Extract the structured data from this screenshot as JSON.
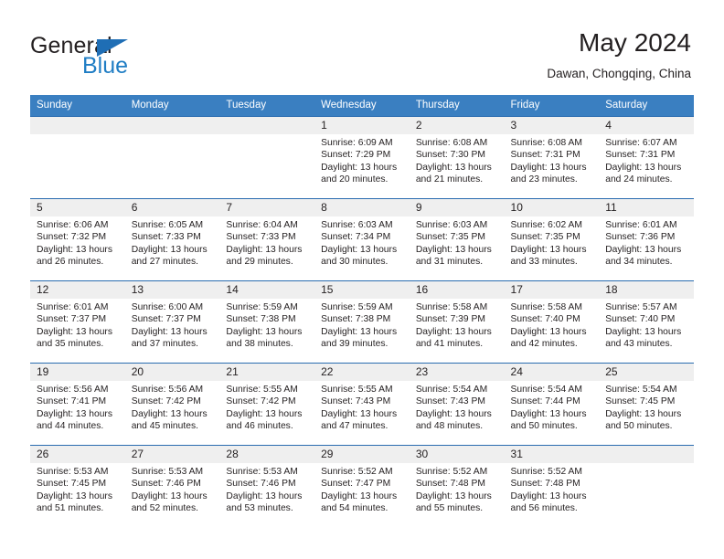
{
  "brand": {
    "word_one": "General",
    "word_two": "Blue",
    "flag_icon": "blue-triangle-flag-icon"
  },
  "header": {
    "title": "May 2024",
    "location": "Dawan, Chongqing, China"
  },
  "colors": {
    "header_blue": "#3a7fc1",
    "rule_blue": "#2a6cb0",
    "brand_blue": "#1f7dc4",
    "daynum_band": "#efefef",
    "text": "#231f20"
  },
  "calendar": {
    "weekday_headers": [
      "Sunday",
      "Monday",
      "Tuesday",
      "Wednesday",
      "Thursday",
      "Friday",
      "Saturday"
    ],
    "labels": {
      "sunrise": "Sunrise:",
      "sunset": "Sunset:",
      "daylight": "Daylight:"
    },
    "weeks": [
      [
        {
          "day": "",
          "empty": true
        },
        {
          "day": "",
          "empty": true
        },
        {
          "day": "",
          "empty": true
        },
        {
          "day": "1",
          "sunrise": "Sunrise: 6:09 AM",
          "sunset": "Sunset: 7:29 PM",
          "daylight_1": "Daylight: 13 hours",
          "daylight_2": "and 20 minutes."
        },
        {
          "day": "2",
          "sunrise": "Sunrise: 6:08 AM",
          "sunset": "Sunset: 7:30 PM",
          "daylight_1": "Daylight: 13 hours",
          "daylight_2": "and 21 minutes."
        },
        {
          "day": "3",
          "sunrise": "Sunrise: 6:08 AM",
          "sunset": "Sunset: 7:31 PM",
          "daylight_1": "Daylight: 13 hours",
          "daylight_2": "and 23 minutes."
        },
        {
          "day": "4",
          "sunrise": "Sunrise: 6:07 AM",
          "sunset": "Sunset: 7:31 PM",
          "daylight_1": "Daylight: 13 hours",
          "daylight_2": "and 24 minutes."
        }
      ],
      [
        {
          "day": "5",
          "sunrise": "Sunrise: 6:06 AM",
          "sunset": "Sunset: 7:32 PM",
          "daylight_1": "Daylight: 13 hours",
          "daylight_2": "and 26 minutes."
        },
        {
          "day": "6",
          "sunrise": "Sunrise: 6:05 AM",
          "sunset": "Sunset: 7:33 PM",
          "daylight_1": "Daylight: 13 hours",
          "daylight_2": "and 27 minutes."
        },
        {
          "day": "7",
          "sunrise": "Sunrise: 6:04 AM",
          "sunset": "Sunset: 7:33 PM",
          "daylight_1": "Daylight: 13 hours",
          "daylight_2": "and 29 minutes."
        },
        {
          "day": "8",
          "sunrise": "Sunrise: 6:03 AM",
          "sunset": "Sunset: 7:34 PM",
          "daylight_1": "Daylight: 13 hours",
          "daylight_2": "and 30 minutes."
        },
        {
          "day": "9",
          "sunrise": "Sunrise: 6:03 AM",
          "sunset": "Sunset: 7:35 PM",
          "daylight_1": "Daylight: 13 hours",
          "daylight_2": "and 31 minutes."
        },
        {
          "day": "10",
          "sunrise": "Sunrise: 6:02 AM",
          "sunset": "Sunset: 7:35 PM",
          "daylight_1": "Daylight: 13 hours",
          "daylight_2": "and 33 minutes."
        },
        {
          "day": "11",
          "sunrise": "Sunrise: 6:01 AM",
          "sunset": "Sunset: 7:36 PM",
          "daylight_1": "Daylight: 13 hours",
          "daylight_2": "and 34 minutes."
        }
      ],
      [
        {
          "day": "12",
          "sunrise": "Sunrise: 6:01 AM",
          "sunset": "Sunset: 7:37 PM",
          "daylight_1": "Daylight: 13 hours",
          "daylight_2": "and 35 minutes."
        },
        {
          "day": "13",
          "sunrise": "Sunrise: 6:00 AM",
          "sunset": "Sunset: 7:37 PM",
          "daylight_1": "Daylight: 13 hours",
          "daylight_2": "and 37 minutes."
        },
        {
          "day": "14",
          "sunrise": "Sunrise: 5:59 AM",
          "sunset": "Sunset: 7:38 PM",
          "daylight_1": "Daylight: 13 hours",
          "daylight_2": "and 38 minutes."
        },
        {
          "day": "15",
          "sunrise": "Sunrise: 5:59 AM",
          "sunset": "Sunset: 7:38 PM",
          "daylight_1": "Daylight: 13 hours",
          "daylight_2": "and 39 minutes."
        },
        {
          "day": "16",
          "sunrise": "Sunrise: 5:58 AM",
          "sunset": "Sunset: 7:39 PM",
          "daylight_1": "Daylight: 13 hours",
          "daylight_2": "and 41 minutes."
        },
        {
          "day": "17",
          "sunrise": "Sunrise: 5:58 AM",
          "sunset": "Sunset: 7:40 PM",
          "daylight_1": "Daylight: 13 hours",
          "daylight_2": "and 42 minutes."
        },
        {
          "day": "18",
          "sunrise": "Sunrise: 5:57 AM",
          "sunset": "Sunset: 7:40 PM",
          "daylight_1": "Daylight: 13 hours",
          "daylight_2": "and 43 minutes."
        }
      ],
      [
        {
          "day": "19",
          "sunrise": "Sunrise: 5:56 AM",
          "sunset": "Sunset: 7:41 PM",
          "daylight_1": "Daylight: 13 hours",
          "daylight_2": "and 44 minutes."
        },
        {
          "day": "20",
          "sunrise": "Sunrise: 5:56 AM",
          "sunset": "Sunset: 7:42 PM",
          "daylight_1": "Daylight: 13 hours",
          "daylight_2": "and 45 minutes."
        },
        {
          "day": "21",
          "sunrise": "Sunrise: 5:55 AM",
          "sunset": "Sunset: 7:42 PM",
          "daylight_1": "Daylight: 13 hours",
          "daylight_2": "and 46 minutes."
        },
        {
          "day": "22",
          "sunrise": "Sunrise: 5:55 AM",
          "sunset": "Sunset: 7:43 PM",
          "daylight_1": "Daylight: 13 hours",
          "daylight_2": "and 47 minutes."
        },
        {
          "day": "23",
          "sunrise": "Sunrise: 5:54 AM",
          "sunset": "Sunset: 7:43 PM",
          "daylight_1": "Daylight: 13 hours",
          "daylight_2": "and 48 minutes."
        },
        {
          "day": "24",
          "sunrise": "Sunrise: 5:54 AM",
          "sunset": "Sunset: 7:44 PM",
          "daylight_1": "Daylight: 13 hours",
          "daylight_2": "and 50 minutes."
        },
        {
          "day": "25",
          "sunrise": "Sunrise: 5:54 AM",
          "sunset": "Sunset: 7:45 PM",
          "daylight_1": "Daylight: 13 hours",
          "daylight_2": "and 50 minutes."
        }
      ],
      [
        {
          "day": "26",
          "sunrise": "Sunrise: 5:53 AM",
          "sunset": "Sunset: 7:45 PM",
          "daylight_1": "Daylight: 13 hours",
          "daylight_2": "and 51 minutes."
        },
        {
          "day": "27",
          "sunrise": "Sunrise: 5:53 AM",
          "sunset": "Sunset: 7:46 PM",
          "daylight_1": "Daylight: 13 hours",
          "daylight_2": "and 52 minutes."
        },
        {
          "day": "28",
          "sunrise": "Sunrise: 5:53 AM",
          "sunset": "Sunset: 7:46 PM",
          "daylight_1": "Daylight: 13 hours",
          "daylight_2": "and 53 minutes."
        },
        {
          "day": "29",
          "sunrise": "Sunrise: 5:52 AM",
          "sunset": "Sunset: 7:47 PM",
          "daylight_1": "Daylight: 13 hours",
          "daylight_2": "and 54 minutes."
        },
        {
          "day": "30",
          "sunrise": "Sunrise: 5:52 AM",
          "sunset": "Sunset: 7:48 PM",
          "daylight_1": "Daylight: 13 hours",
          "daylight_2": "and 55 minutes."
        },
        {
          "day": "31",
          "sunrise": "Sunrise: 5:52 AM",
          "sunset": "Sunset: 7:48 PM",
          "daylight_1": "Daylight: 13 hours",
          "daylight_2": "and 56 minutes."
        },
        {
          "day": "",
          "empty": true
        }
      ]
    ]
  }
}
